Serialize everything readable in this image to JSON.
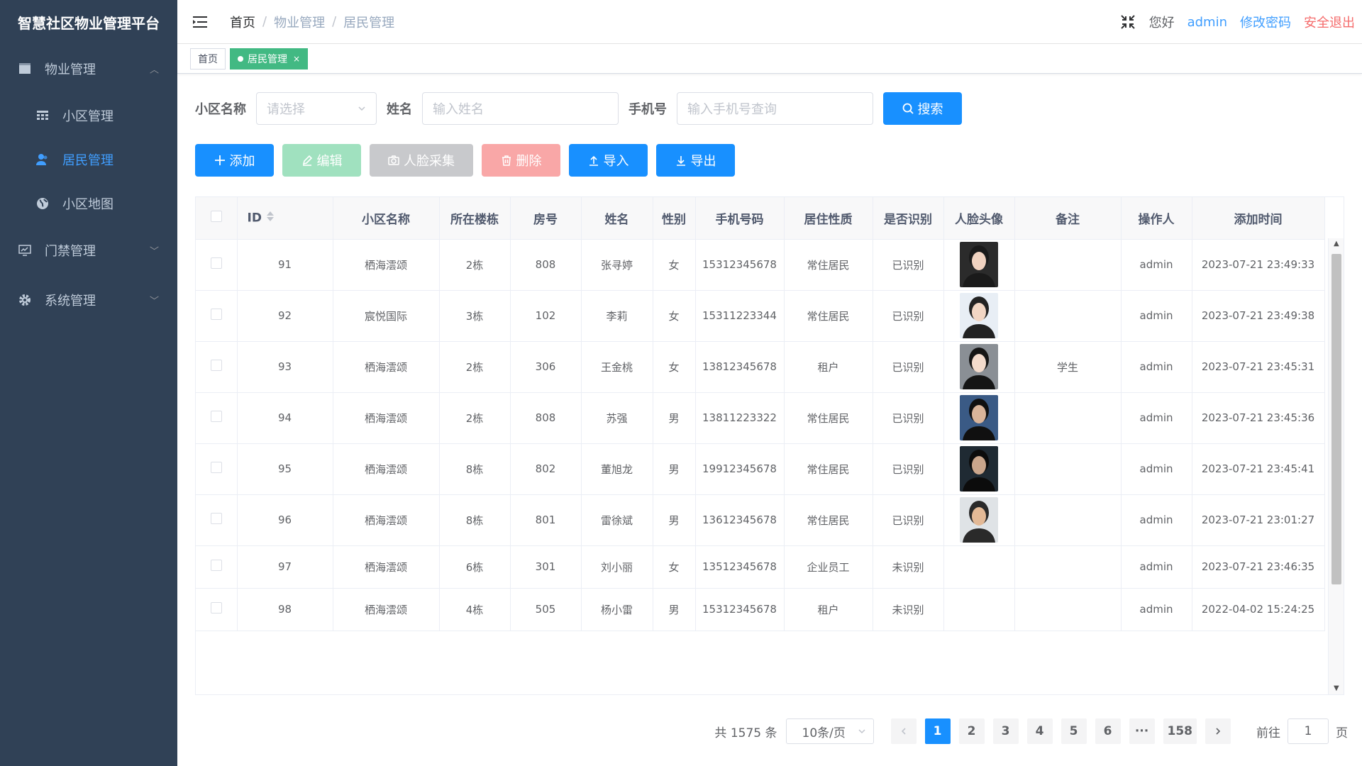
{
  "app": {
    "title": "智慧社区物业管理平台"
  },
  "sidebar": {
    "groups": [
      {
        "label": "物业管理",
        "icon": "building-icon",
        "expanded": true,
        "items": [
          {
            "label": "小区管理",
            "icon": "grid-icon",
            "active": false
          },
          {
            "label": "居民管理",
            "icon": "user-icon",
            "active": true
          },
          {
            "label": "小区地图",
            "icon": "globe-icon",
            "active": false
          }
        ]
      },
      {
        "label": "门禁管理",
        "icon": "monitor-icon",
        "expanded": false
      },
      {
        "label": "系统管理",
        "icon": "gear-icon",
        "expanded": false
      }
    ]
  },
  "header": {
    "breadcrumb": [
      "首页",
      "物业管理",
      "居民管理"
    ],
    "breadcrumb_sep": "/",
    "greeting": "您好",
    "user": "admin",
    "change_password": "修改密码",
    "logout": "安全退出"
  },
  "tags": [
    {
      "label": "首页",
      "active": false
    },
    {
      "label": "居民管理",
      "active": true,
      "close": "×"
    }
  ],
  "search": {
    "community_label": "小区名称",
    "community_placeholder": "请选择",
    "name_label": "姓名",
    "name_placeholder": "输入姓名",
    "phone_label": "手机号",
    "phone_placeholder": "输入手机号查询",
    "search_button": "搜索"
  },
  "toolbar": {
    "add": "添加",
    "edit": "编辑",
    "face": "人脸采集",
    "delete": "删除",
    "import": "导入",
    "export": "导出"
  },
  "table": {
    "columns": [
      "ID",
      "小区名称",
      "所在楼栋",
      "房号",
      "姓名",
      "性别",
      "手机号码",
      "居住性质",
      "是否识别",
      "人脸头像",
      "备注",
      "操作人",
      "添加时间"
    ],
    "rows": [
      {
        "id": "91",
        "community": "栖海澐颂",
        "building": "2栋",
        "room": "808",
        "name": "张寻婷",
        "gender": "女",
        "phone": "15312345678",
        "type": "常住居民",
        "recognized": "已识别",
        "avatar": "face-1",
        "note": "",
        "operator": "admin",
        "time": "2023-07-21 23:49:33"
      },
      {
        "id": "92",
        "community": "宸悦国际",
        "building": "3栋",
        "room": "102",
        "name": "李莉",
        "gender": "女",
        "phone": "15311223344",
        "type": "常住居民",
        "recognized": "已识别",
        "avatar": "face-2",
        "note": "",
        "operator": "admin",
        "time": "2023-07-21 23:49:38"
      },
      {
        "id": "93",
        "community": "栖海澐颂",
        "building": "2栋",
        "room": "306",
        "name": "王金桃",
        "gender": "女",
        "phone": "13812345678",
        "type": "租户",
        "recognized": "已识别",
        "avatar": "face-3",
        "note": "学生",
        "operator": "admin",
        "time": "2023-07-21 23:45:31"
      },
      {
        "id": "94",
        "community": "栖海澐颂",
        "building": "2栋",
        "room": "808",
        "name": "苏强",
        "gender": "男",
        "phone": "13811223322",
        "type": "常住居民",
        "recognized": "已识别",
        "avatar": "face-4",
        "note": "",
        "operator": "admin",
        "time": "2023-07-21 23:45:36"
      },
      {
        "id": "95",
        "community": "栖海澐颂",
        "building": "8栋",
        "room": "802",
        "name": "董旭龙",
        "gender": "男",
        "phone": "19912345678",
        "type": "常住居民",
        "recognized": "已识别",
        "avatar": "face-5",
        "note": "",
        "operator": "admin",
        "time": "2023-07-21 23:45:41"
      },
      {
        "id": "96",
        "community": "栖海澐颂",
        "building": "8栋",
        "room": "801",
        "name": "雷徐斌",
        "gender": "男",
        "phone": "13612345678",
        "type": "常住居民",
        "recognized": "已识别",
        "avatar": "face-6",
        "note": "",
        "operator": "admin",
        "time": "2023-07-21 23:01:27"
      },
      {
        "id": "97",
        "community": "栖海澐颂",
        "building": "6栋",
        "room": "301",
        "name": "刘小丽",
        "gender": "女",
        "phone": "13512345678",
        "type": "企业员工",
        "recognized": "未识别",
        "avatar": "",
        "note": "",
        "operator": "admin",
        "time": "2023-07-21 23:46:35"
      },
      {
        "id": "98",
        "community": "栖海澐颂",
        "building": "4栋",
        "room": "505",
        "name": "杨小雷",
        "gender": "男",
        "phone": "15312345678",
        "type": "租户",
        "recognized": "未识别",
        "avatar": "",
        "note": "",
        "operator": "admin",
        "time": "2022-04-02 15:24:25"
      }
    ]
  },
  "pagination": {
    "total_text": "共 1575 条",
    "page_size": "10条/页",
    "pages": [
      "1",
      "2",
      "3",
      "4",
      "5",
      "6",
      "···",
      "158"
    ],
    "current": "1",
    "goto_prefix": "前往",
    "goto_value": "1",
    "goto_suffix": "页"
  },
  "colors": {
    "sidebar_bg": "#304156",
    "primary": "#1890ff",
    "active_tag": "#42b983",
    "danger": "#f56c6c"
  }
}
